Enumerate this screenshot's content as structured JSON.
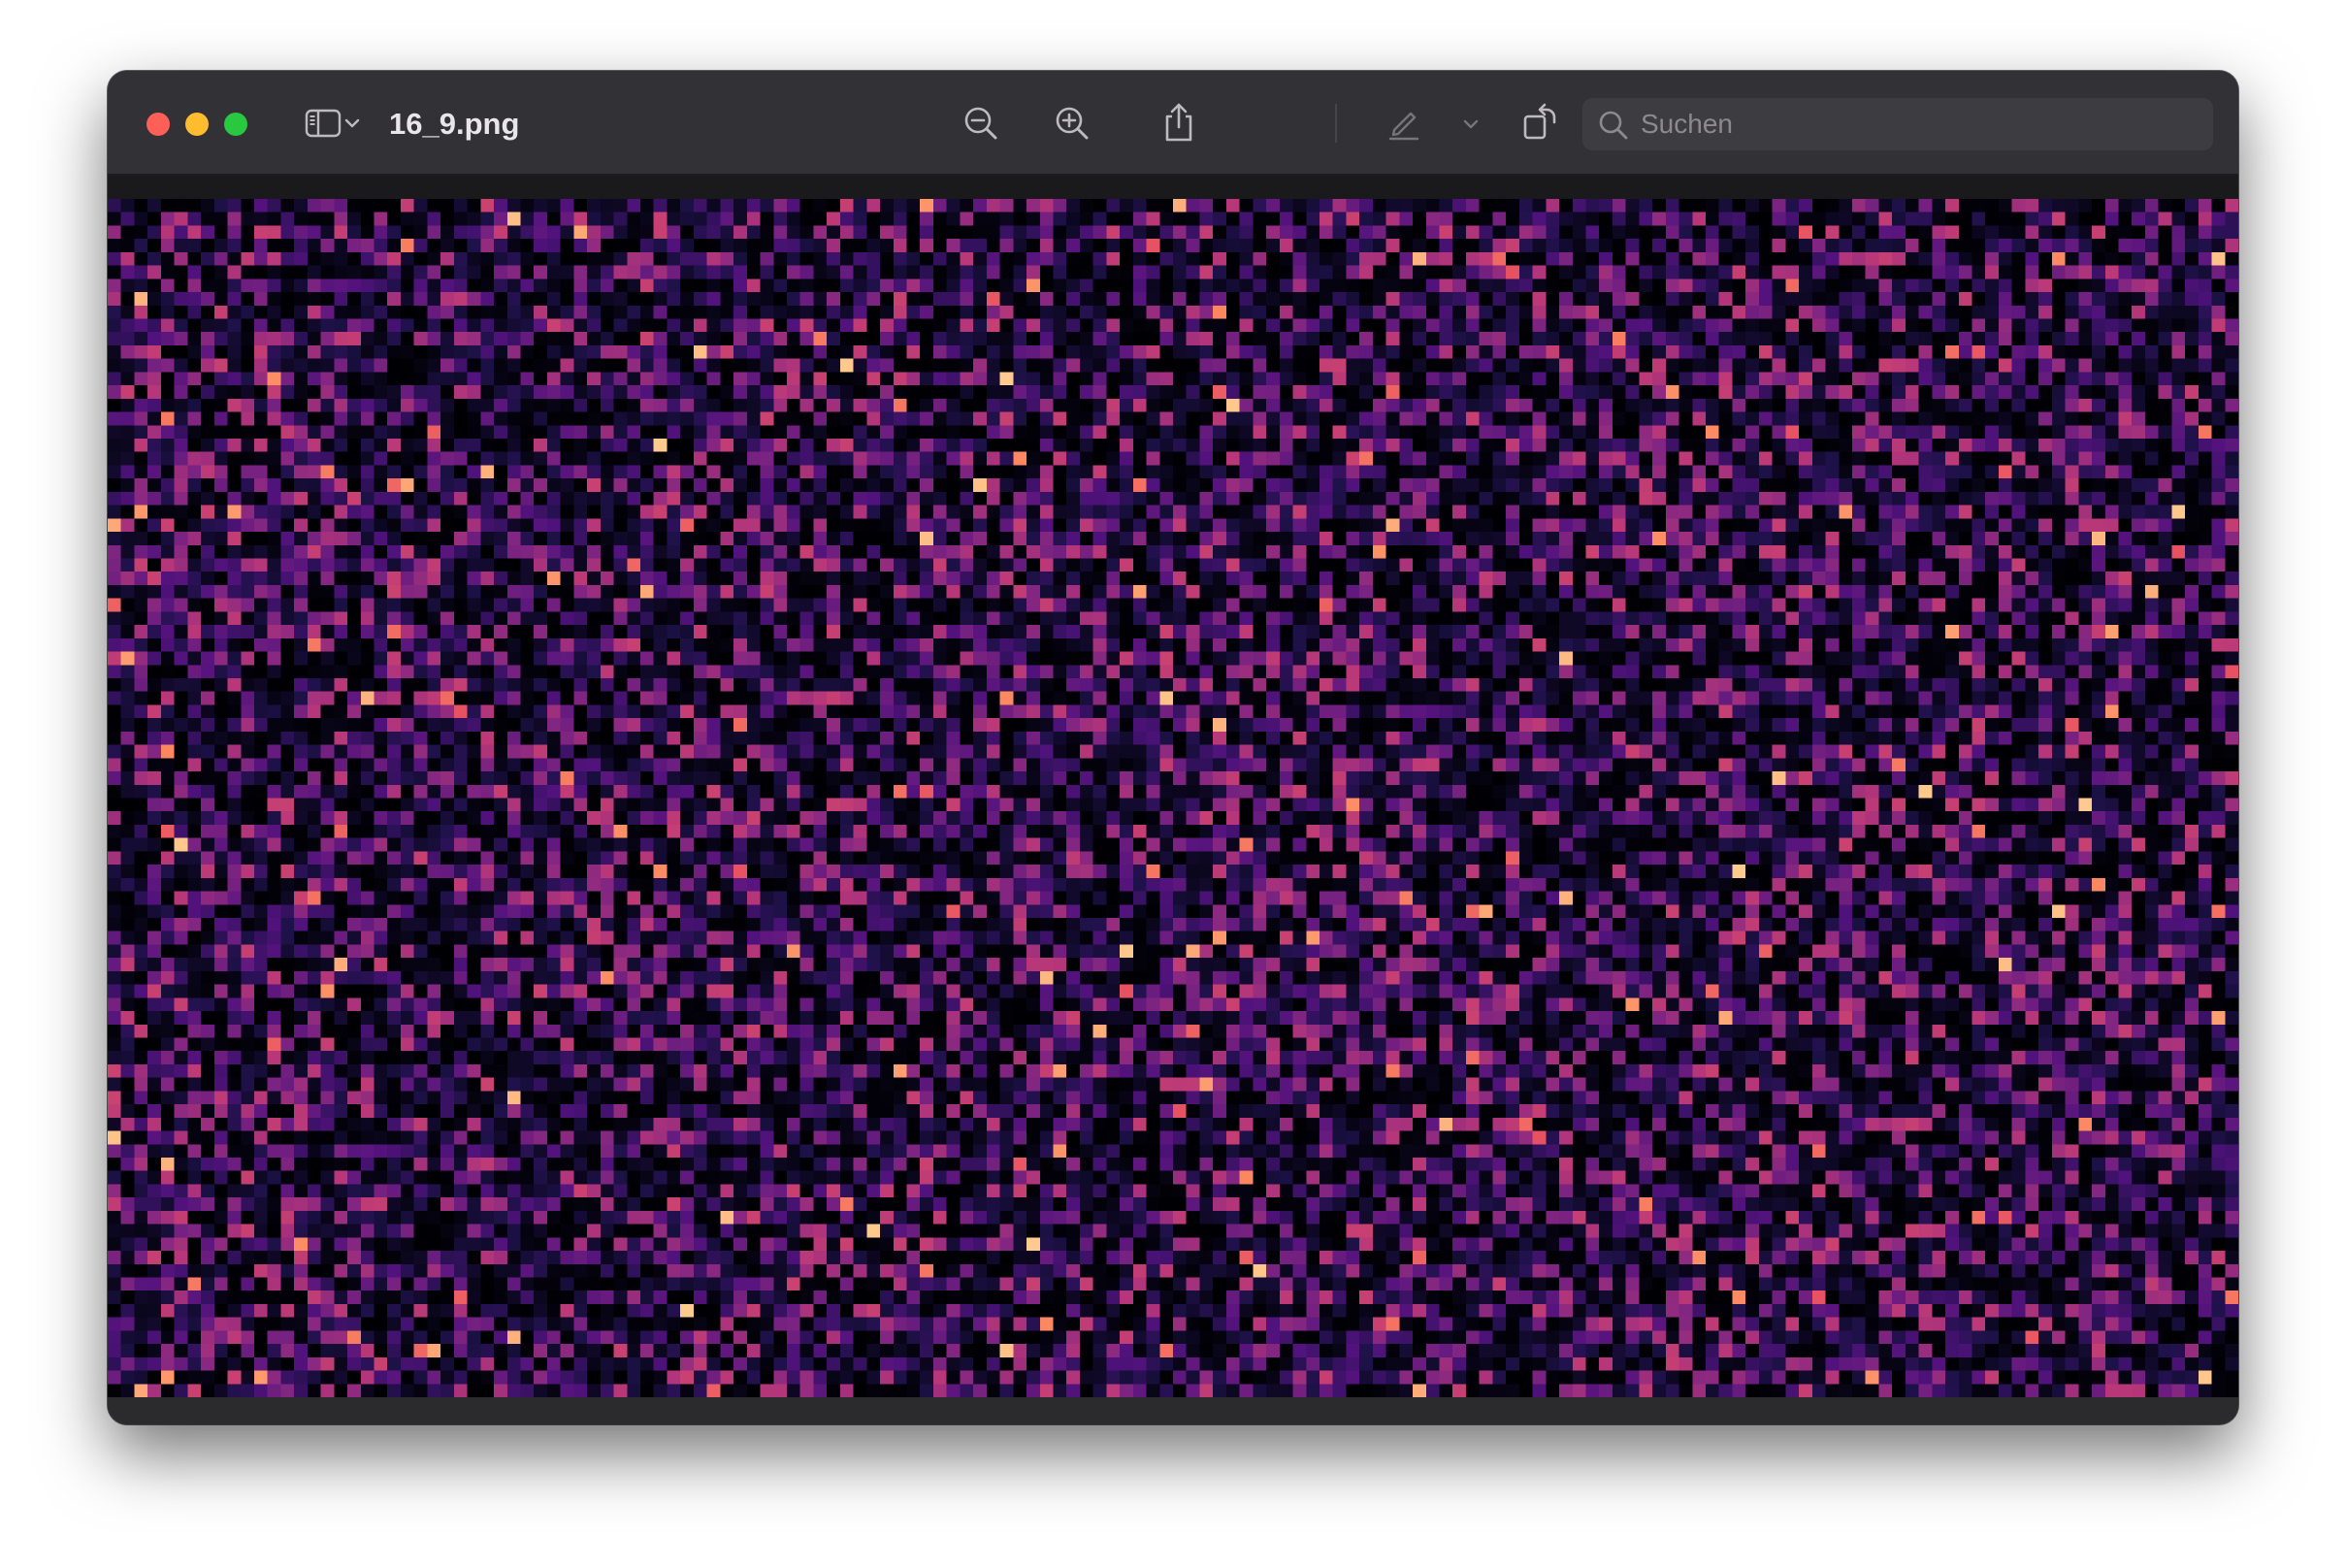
{
  "window": {
    "title": "16_9.png"
  },
  "toolbar": {
    "sidebar_toggle_icon": "sidebar-icon",
    "zoom_out_icon": "zoom-out-icon",
    "zoom_in_icon": "zoom-in-icon",
    "share_icon": "share-icon",
    "markup_icon": "pen-icon",
    "rotate_icon": "rotate-icon",
    "annotate_icon": "markup-circle-icon"
  },
  "search": {
    "placeholder": "Suchen",
    "value": ""
  },
  "colors": {
    "traffic_red": "#fe5f57",
    "traffic_yellow": "#febc2e",
    "traffic_green": "#28c840",
    "colormap": [
      "#000004",
      "#1d1147",
      "#51127c",
      "#822681",
      "#b73779",
      "#e75263",
      "#fc8961",
      "#fecf92",
      "#fcfdbf"
    ]
  },
  "image_content": {
    "description_kind": "heatmap-noise",
    "grid_columns": 160,
    "grid_rows": 90
  }
}
